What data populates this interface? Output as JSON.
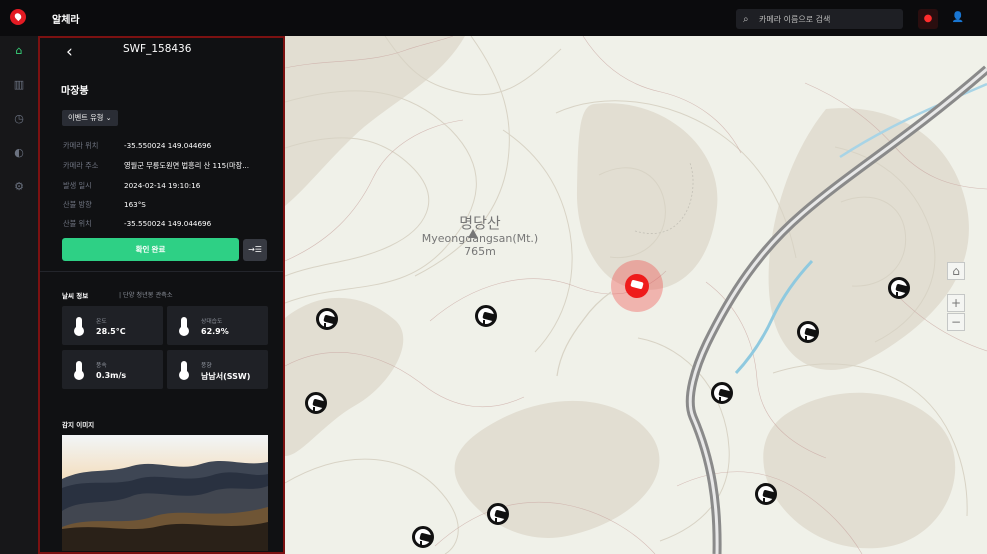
{
  "app": {
    "title": "알체라"
  },
  "header": {
    "search_placeholder": "카메라 이름으로 검색",
    "search_icon": "search-icon",
    "bell_icon": "bell-icon",
    "user_icon": "user-icon"
  },
  "sidebar": {
    "items": [
      {
        "name": "home",
        "icon": "home-icon"
      },
      {
        "name": "map",
        "icon": "map-icon"
      },
      {
        "name": "history",
        "icon": "history-icon"
      },
      {
        "name": "camera",
        "icon": "camera-icon"
      },
      {
        "name": "settings",
        "icon": "settings-icon"
      }
    ]
  },
  "panel": {
    "camera_id": "SWF_158436",
    "place": "마장봉",
    "event_type_label": "이벤트 유형 ⌄",
    "details": [
      {
        "label": "카메라 위치",
        "value": "-35.550024 149.044696"
      },
      {
        "label": "카메라 주소",
        "value": "영월군 무릉도원면 법흥리 산 115(마장..."
      },
      {
        "label": "발생 일시",
        "value": "2024-02-14 19:10:16"
      },
      {
        "label": "산불 방향",
        "value": "163°S"
      },
      {
        "label": "산불 위치",
        "value": "-35.550024 149.044696"
      }
    ],
    "confirm_label": "확인 완료",
    "weather_title": "날씨 정보",
    "weather_station": "| 단양 청년봉 관측소",
    "weather": [
      {
        "label": "온도",
        "value": "28.5°C"
      },
      {
        "label": "상대습도",
        "value": "62.9%"
      },
      {
        "label": "풍속",
        "value": "0.3m/s"
      },
      {
        "label": "풍향",
        "value": "남남서(SSW)"
      }
    ],
    "image_title": "감지 이미지"
  },
  "map": {
    "peak_ko": "명당산",
    "peak_en": "Myeongdangsan(Mt.)",
    "peak_height": "765m",
    "controls": {
      "home": "⌂",
      "plus": "+",
      "minus": "−"
    },
    "accent": "#ef1b1b"
  },
  "colors": {
    "confirm": "#2ed085",
    "alert": "#ef1b1b",
    "topbar": "#0b0b0d"
  }
}
